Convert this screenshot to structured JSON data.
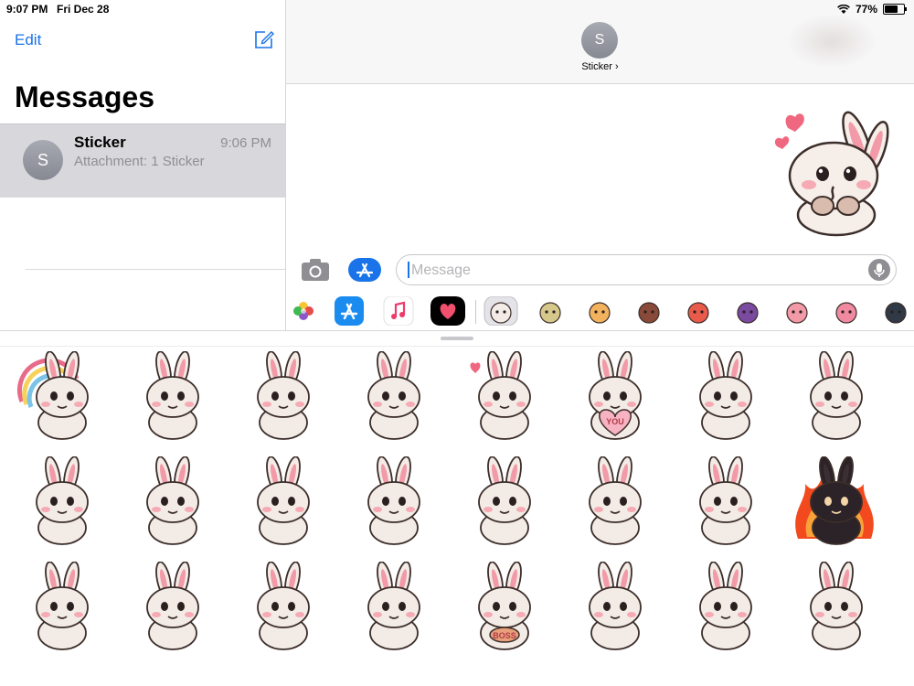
{
  "status": {
    "time": "9:07 PM",
    "date": "Fri Dec 28",
    "battery": "77%",
    "battery_level": 0.77
  },
  "sidebar": {
    "edit_label": "Edit",
    "title": "Messages",
    "conversation": {
      "avatar_letter": "S",
      "name": "Sticker",
      "time": "9:06 PM",
      "preview": "Attachment: 1 Sticker"
    }
  },
  "header": {
    "avatar_letter": "S",
    "contact": "Sticker ›"
  },
  "composer": {
    "placeholder": "Message"
  },
  "colors": {
    "accent": "#1a73e8",
    "selection": "#d8d8dc",
    "bunny": "#f3ebe6",
    "ear": "#f29aa8"
  },
  "apps": [
    {
      "name": "photos"
    },
    {
      "name": "app-store"
    },
    {
      "name": "music"
    },
    {
      "name": "digital-touch"
    },
    {
      "name": "bunny-pack"
    },
    {
      "name": "pack-2"
    },
    {
      "name": "pack-3"
    },
    {
      "name": "pack-4"
    },
    {
      "name": "pack-5"
    },
    {
      "name": "pack-6"
    },
    {
      "name": "pack-7"
    },
    {
      "name": "pack-8"
    },
    {
      "name": "pack-9"
    }
  ],
  "stickers": [
    {
      "mood": "rainbow"
    },
    {
      "mood": "shy"
    },
    {
      "mood": "cheer"
    },
    {
      "mood": "cute"
    },
    {
      "mood": "kiss"
    },
    {
      "mood": "you-heart",
      "text": "YOU"
    },
    {
      "mood": "sparkle"
    },
    {
      "mood": "wink"
    },
    {
      "mood": "happy"
    },
    {
      "mood": "smug"
    },
    {
      "mood": "confused"
    },
    {
      "mood": "think"
    },
    {
      "mood": "thinking"
    },
    {
      "mood": "lying"
    },
    {
      "mood": "sleepy"
    },
    {
      "mood": "angry"
    },
    {
      "mood": "hide"
    },
    {
      "mood": "laugh"
    },
    {
      "mood": "cry"
    },
    {
      "mood": "carrot"
    },
    {
      "mood": "boss",
      "text": "BOSS"
    },
    {
      "mood": "cookie"
    },
    {
      "mood": "sleep"
    },
    {
      "mood": "sick"
    }
  ]
}
